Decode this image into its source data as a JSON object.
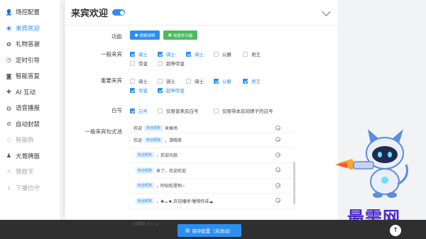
{
  "sidebar": {
    "items": [
      {
        "icon": "user-icon",
        "glyph": "👤",
        "label": "场控配置",
        "state": "normal"
      },
      {
        "icon": "welcome-icon",
        "glyph": "◉",
        "label": "来宾欢迎",
        "state": "active"
      },
      {
        "icon": "gift-icon",
        "glyph": "✿",
        "label": "礼物答谢",
        "state": "normal"
      },
      {
        "icon": "clock-icon",
        "glyph": "◷",
        "label": "定时引导",
        "state": "normal"
      },
      {
        "icon": "bubble-icon",
        "glyph": "◙",
        "label": "智能答复",
        "state": "normal"
      },
      {
        "icon": "ai-icon",
        "glyph": "✚",
        "label": "AI 互动",
        "state": "normal"
      },
      {
        "icon": "voice-icon",
        "glyph": "◍",
        "label": "语音播报",
        "state": "normal"
      },
      {
        "icon": "ban-icon",
        "glyph": "⊘",
        "label": "自动封禁",
        "state": "normal"
      },
      {
        "icon": "diamond-icon",
        "glyph": "◇",
        "label": "智能购",
        "state": "dim"
      },
      {
        "icon": "screen-icon",
        "glyph": "♟",
        "label": "大哥牌面",
        "state": "normal"
      },
      {
        "icon": "hash-icon",
        "glyph": "⌗",
        "label": "猜数字",
        "state": "dim"
      },
      {
        "icon": "download-icon",
        "glyph": "⤓",
        "label": "下播信守",
        "state": "dim"
      }
    ]
  },
  "header": {
    "title": "来宾欢迎",
    "enabled": true
  },
  "function_row": {
    "label": "功能",
    "btn_video": "视频说明",
    "btn_template": "快速本功能"
  },
  "normal_guest": {
    "label": "一般来宾",
    "options": [
      {
        "text": "骑士",
        "checked": true
      },
      {
        "text": "骑士",
        "checked": true
      },
      {
        "text": "骑士",
        "checked": true
      },
      {
        "text": "公爵",
        "checked": false
      },
      {
        "text": "君王",
        "checked": false
      },
      {
        "text": "帝皇",
        "checked": false
      },
      {
        "text": "超神帝皇",
        "checked": false
      }
    ]
  },
  "important_guest": {
    "label": "重要来宾",
    "options": [
      {
        "text": "骑士",
        "checked": false
      },
      {
        "text": "骑士",
        "checked": false
      },
      {
        "text": "骑士",
        "checked": false
      },
      {
        "text": "公爵",
        "checked": true
      },
      {
        "text": "君王",
        "checked": true
      },
      {
        "text": "帝皇",
        "checked": true
      },
      {
        "text": "超神帝皇",
        "checked": true
      }
    ]
  },
  "white_row": {
    "label": "白号",
    "options": [
      {
        "text": "白号",
        "checked": true
      },
      {
        "text": "仅限曾来房白号",
        "checked": false
      },
      {
        "text": "仅限带本房间牌子的白号",
        "checked": false
      }
    ]
  },
  "message_section": {
    "label": "一般来宾句式池",
    "tag": "粉丝昵称",
    "items": [
      {
        "prefix": "欢迎",
        "suffix": "来捧场"
      },
      {
        "prefix": "欢迎",
        "suffix": "，请喝茶"
      },
      {
        "prefix": "",
        "suffix": "，欢迎光临"
      },
      {
        "prefix": "",
        "suffix": "来了，欢迎欢迎"
      },
      {
        "prefix": "",
        "suffix": "，阿哒啦里哟~"
      },
      {
        "prefix": "",
        "suffix": "，♣ﺕ♠,欢迎播场·喔唷你讲☁"
      }
    ]
  },
  "footer": {
    "save_label": "保存配置（未改动）",
    "faint_text": "小提建议  ◎  ◎  ◎"
  },
  "watermark": "最需网",
  "colors": {
    "accent": "#2b8ef0",
    "green": "#4cbb5e",
    "footer": "#2f2f2f",
    "watermark": "#4a2bc8"
  }
}
